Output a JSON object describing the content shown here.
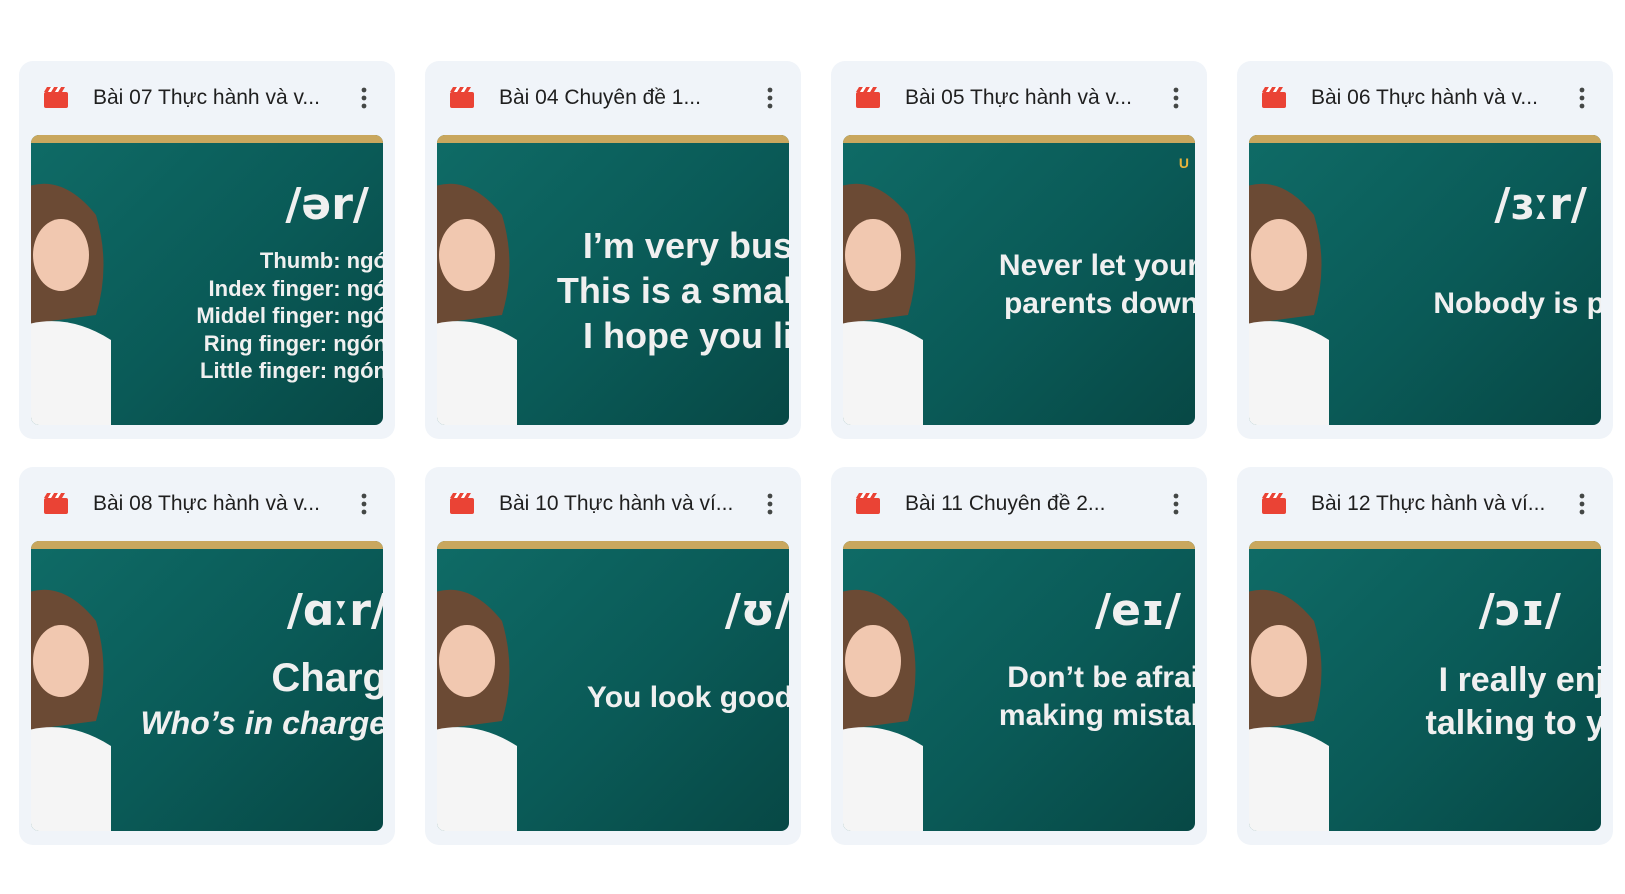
{
  "cards": [
    {
      "title": "Bài 07 Thực hành và v...",
      "icon": "video-icon",
      "thumb": {
        "ipa": "/ər/",
        "lines": [
          "Thumb: ngó",
          "Index finger: ngó",
          "Middel finger: ngó",
          "Ring finger: ngón",
          "Little finger: ngón"
        ]
      }
    },
    {
      "title": "Bài 04 Chuyên đề 1...",
      "icon": "video-icon",
      "thumb": {
        "ipa": "",
        "lines": [
          "I’m very bus",
          "This is a smal",
          "I hope you li"
        ]
      }
    },
    {
      "title": "Bài 05 Thực hành và v...",
      "icon": "video-icon",
      "thumb": {
        "ipa": "",
        "badge": "U",
        "lines": [
          "Never let your",
          "parents down"
        ]
      }
    },
    {
      "title": "Bài 06 Thực hành và v...",
      "icon": "video-icon",
      "thumb": {
        "ipa": "/ɜːr/",
        "lines": [
          "Nobody is p"
        ]
      }
    },
    {
      "title": "Bài 08 Thực hành và v...",
      "icon": "video-icon",
      "thumb": {
        "ipa": "/ɑːr/",
        "lines": [
          "Charg",
          "Who’s in charge"
        ]
      }
    },
    {
      "title": "Bài 10 Thực hành và ví...",
      "icon": "video-icon",
      "thumb": {
        "ipa": "/ʊ/",
        "lines": [
          "You look good"
        ]
      }
    },
    {
      "title": "Bài 11 Chuyên đề 2...",
      "icon": "video-icon",
      "thumb": {
        "ipa": "/eɪ/",
        "lines": [
          "Don’t be afrai",
          "making mistal"
        ]
      }
    },
    {
      "title": "Bài 12 Thực hành và ví...",
      "icon": "video-icon",
      "thumb": {
        "ipa": "/ɔɪ/",
        "lines": [
          "I really enj",
          "talking to y"
        ]
      }
    }
  ],
  "colors": {
    "card_bg": "#f0f4f9",
    "video_icon": "#ea4335",
    "thumb_bg": "#0a5a57",
    "thumb_border": "#c9a75e",
    "title_text": "#1f1f1f"
  }
}
